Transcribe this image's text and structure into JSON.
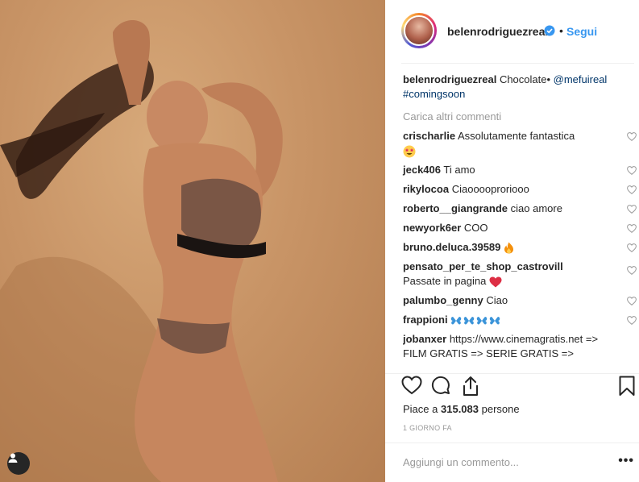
{
  "header": {
    "username": "belenrodriguezreal",
    "verified": true,
    "separator": "•",
    "follow_label": "Segui"
  },
  "caption": {
    "username": "belenrodriguezreal",
    "text": "Chocolate•",
    "mention": "@mefuireal",
    "hashtag": "#comingsoon"
  },
  "load_more_label": "Carica altri commenti",
  "comments": [
    {
      "user": "crischarlie",
      "text": "Assolutamente fantastica",
      "emoji": "star-struck"
    },
    {
      "user": "jeck406",
      "text": "Ti amo"
    },
    {
      "user": "rikylocoa",
      "text": "Ciaooooproriooo"
    },
    {
      "user": "roberto__giangrande",
      "text": "ciao amore"
    },
    {
      "user": "newyork6er",
      "text": "COO"
    },
    {
      "user": "bruno.deluca.39589",
      "text": "",
      "emoji": "fire"
    },
    {
      "user": "pensato_per_te_shop_castrovill",
      "text": "Passate in pagina",
      "emoji": "red-heart"
    },
    {
      "user": "palumbo_genny",
      "text": "Ciao"
    },
    {
      "user": "frappioni",
      "text": "",
      "emoji": "butterflies"
    },
    {
      "user": "jobanxer",
      "text": "https://www.cinemagratis.net => FILM GRATIS => SERIE GRATIS => CARTONI ANIMATI GRATIS =>"
    }
  ],
  "likes": {
    "prefix": "Piace a",
    "count": "315.083",
    "suffix": "persone"
  },
  "timestamp": "1 GIORNO FA",
  "add_comment_placeholder": "Aggiungi un commento...",
  "more_label": "•••",
  "icons": {
    "heart": "heart-icon",
    "comment": "comment-icon",
    "share": "share-icon",
    "save": "bookmark-icon",
    "user_tag": "user-tag-icon",
    "verified": "verified-badge-icon"
  },
  "colors": {
    "follow": "#3897f0",
    "mention": "#003569",
    "verified": "#3897f0",
    "muted": "#999999",
    "text": "#262626"
  }
}
